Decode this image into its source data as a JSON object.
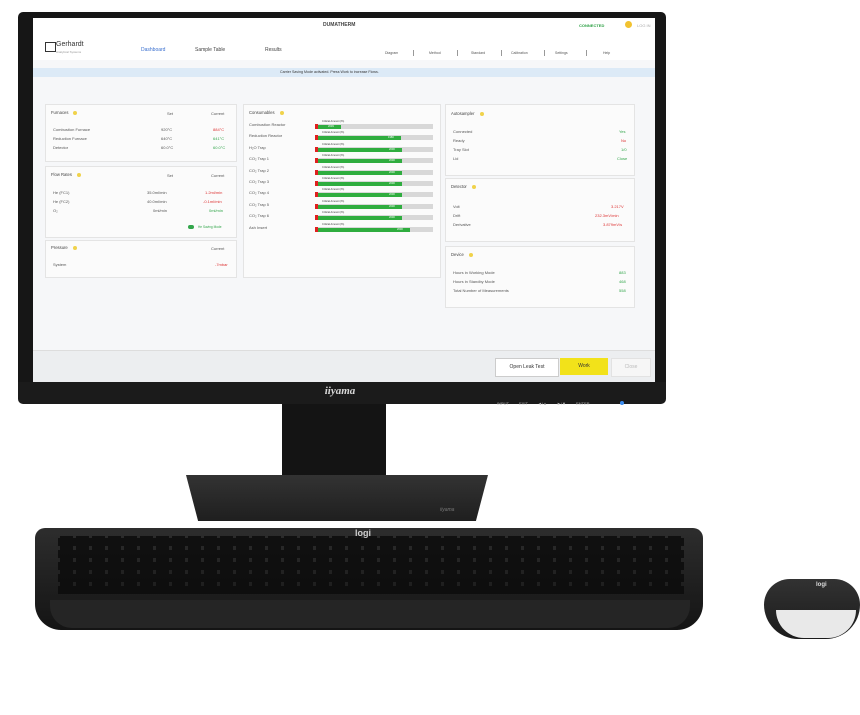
{
  "app": {
    "title": "DUMATHERM",
    "connection": "CONNECTED",
    "user": "LOG IN",
    "brand_name": "Gerhardt",
    "brand_tagline": "Analytical Systems"
  },
  "nav": {
    "main": [
      "Dashboard",
      "Sample Table",
      "Results"
    ],
    "secondary": [
      "Diagram",
      "Method",
      "Standard",
      "Calibration",
      "Settings",
      "Help"
    ]
  },
  "info_message": "Carrier Saving Mode activated. Press Work to increase Flows.",
  "furnaces": {
    "title": "Furnaces",
    "col_set": "Set",
    "col_current": "Current",
    "rows": [
      {
        "name": "Combustion Furnace",
        "set": "920°C",
        "current": "884°C"
      },
      {
        "name": "Reduction Furnace",
        "set": "640°C",
        "current": "641°C"
      },
      {
        "name": "Detector",
        "set": "60.0°C",
        "current": "60.0°C"
      }
    ]
  },
  "flow_rates": {
    "title": "Flow Rates",
    "col_set": "Set",
    "col_current": "Current",
    "rows": [
      {
        "name": "He (FC1)",
        "set": "35.0ml/min",
        "current": "1.2ml/min"
      },
      {
        "name": "He (FC2)",
        "set": "40.0ml/min",
        "current": "-0.1ml/min"
      },
      {
        "name": "O₂",
        "set": "0ml/min",
        "current": "0ml/min"
      }
    ],
    "gas_saving": "He Saving Mode"
  },
  "pressure": {
    "title": "Pressure",
    "col_current": "Current",
    "rows": [
      {
        "name": "System",
        "current": "-7mbar"
      }
    ]
  },
  "consumables": {
    "title": "Consumables",
    "items": [
      {
        "name": "Combustion Reactor",
        "alert": "Critical Amount (%)",
        "value": "2039",
        "level": 0.2
      },
      {
        "name": "Reduction Reactor",
        "alert": "Critical Amount (%)",
        "value": "1980",
        "level": 0.72
      },
      {
        "name": "H₂O Trap",
        "alert": "Critical Amount (%)",
        "value": "2000",
        "level": 0.73
      },
      {
        "name": "CO₂ Trap 1",
        "alert": "Critical Amount (%)",
        "value": "2000",
        "level": 0.73
      },
      {
        "name": "CO₂ Trap 2",
        "alert": "Critical Amount (%)",
        "value": "2000",
        "level": 0.73
      },
      {
        "name": "CO₂ Trap 3",
        "alert": "Critical Amount (%)",
        "value": "2000",
        "level": 0.73
      },
      {
        "name": "CO₂ Trap 4",
        "alert": "Critical Amount (%)",
        "value": "2000",
        "level": 0.73
      },
      {
        "name": "CO₂ Trap 5",
        "alert": "Critical Amount (%)",
        "value": "2000",
        "level": 0.73
      },
      {
        "name": "CO₂ Trap 6",
        "alert": "Critical Amount (%)",
        "value": "2000",
        "level": 0.73
      },
      {
        "name": "Ash Insert",
        "alert": "Critical Amount (%)",
        "value": "2000",
        "level": 0.8
      }
    ]
  },
  "autosampler": {
    "title": "Autosampler",
    "rows": [
      {
        "name": "Connected",
        "value": "Yes"
      },
      {
        "name": "Ready",
        "value": "No"
      },
      {
        "name": "Tray Slot",
        "value": "1/0"
      },
      {
        "name": "Lid",
        "value": "Close"
      }
    ]
  },
  "detector": {
    "title": "Detector",
    "rows": [
      {
        "name": "Volt",
        "value": "3.217V"
      },
      {
        "name": "Drift",
        "value": "232.3mV/min"
      },
      {
        "name": "Derivative",
        "value": "3.879mV/s"
      }
    ]
  },
  "device": {
    "title": "Device",
    "rows": [
      {
        "name": "Hours in Working Mode",
        "value": "883"
      },
      {
        "name": "Hours in Standby Mode",
        "value": "468"
      },
      {
        "name": "Total Number of Measurements",
        "value": "558"
      }
    ]
  },
  "footer": {
    "leak_test": "Open Leak Test",
    "work": "Work",
    "close": "Close"
  },
  "hardware": {
    "monitor_brand": "iiyama",
    "monitor_buttons": [
      "INPUT",
      "EXIT",
      "◄/▲",
      "►/▼",
      "ENTER"
    ],
    "keyboard_brand": "logi",
    "mouse_brand": "logi",
    "stand_brand": "iiyama"
  },
  "colors": {
    "accent": "#3a6fcf",
    "ok": "#33a64b",
    "alert": "#dd3333",
    "work_button": "#f2e21a",
    "info_bar": "#dceaf7"
  }
}
